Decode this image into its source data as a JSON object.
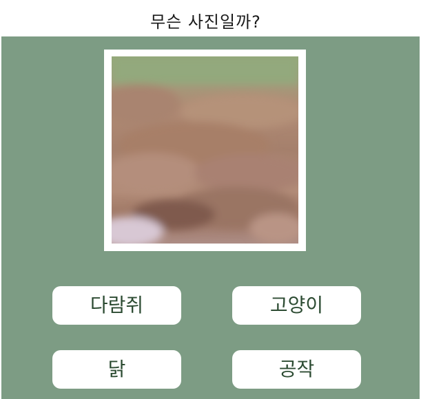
{
  "quiz": {
    "title": "무슨 사진일까?",
    "photo_alt": "",
    "answers": [
      "다람쥐",
      "고양이",
      "닭",
      "공작"
    ]
  },
  "colors": {
    "panel_bg": "#7d9c84",
    "button_bg": "#ffffff",
    "button_text": "#2c4b32",
    "frame": "#ffffff"
  }
}
